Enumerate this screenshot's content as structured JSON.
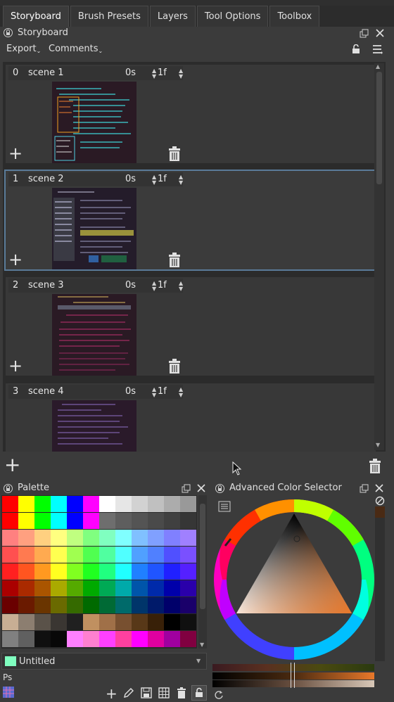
{
  "tabs": [
    {
      "label": "Storyboard",
      "active": true
    },
    {
      "label": "Brush Presets",
      "active": false
    },
    {
      "label": "Layers",
      "active": false
    },
    {
      "label": "Tool Options",
      "active": false
    },
    {
      "label": "Toolbox",
      "active": false
    }
  ],
  "storyboard": {
    "title": "Storyboard",
    "export_label": "Export",
    "comments_label": "Comments",
    "scenes": [
      {
        "index": "0",
        "name": "scene 1",
        "duration": "0s",
        "frames": "1f",
        "selected": false
      },
      {
        "index": "1",
        "name": "scene 2",
        "duration": "0s",
        "frames": "1f",
        "selected": true
      },
      {
        "index": "2",
        "name": "scene 3",
        "duration": "0s",
        "frames": "1f",
        "selected": false
      },
      {
        "index": "3",
        "name": "scene 4",
        "duration": "0s",
        "frames": "1f",
        "selected": false
      }
    ]
  },
  "palette": {
    "title": "Palette",
    "name": "Untitled",
    "ps_label": "Ps",
    "rows": [
      [
        "#ff0000",
        "#ffff00",
        "#00ff00",
        "#00ffff",
        "#0000ff",
        "#ff00ff",
        "#ffffff",
        "#e6e6e6",
        "#d2d2d2",
        "#c0c0c0",
        "#acacac",
        "#999999"
      ],
      [
        "#ff0000",
        "#ffff00",
        "#00ff00",
        "#00ffff",
        "#0000ff",
        "#ff00ff",
        "#6e6e6e",
        "#5e5e5e",
        "#545454",
        "#4a4a4a",
        "#404040",
        "#363636"
      ],
      [
        "#ff8080",
        "#ffa080",
        "#ffd080",
        "#ffff80",
        "#c0ff80",
        "#80ff80",
        "#80ffc0",
        "#80ffff",
        "#80c0ff",
        "#80a0ff",
        "#8080ff",
        "#a080ff"
      ],
      [
        "#ff5050",
        "#ff7a50",
        "#ffaa50",
        "#ffff50",
        "#a0ff50",
        "#50ff50",
        "#50ffa0",
        "#50ffff",
        "#50a0ff",
        "#5080ff",
        "#5050ff",
        "#7a50ff"
      ],
      [
        "#ff2020",
        "#ff5520",
        "#ff9920",
        "#ffff20",
        "#80ff20",
        "#20ff20",
        "#20ff80",
        "#20ffff",
        "#2080ff",
        "#2055ff",
        "#2020ff",
        "#5520ff"
      ],
      [
        "#aa0000",
        "#aa2a00",
        "#aa5500",
        "#aaaa00",
        "#55aa00",
        "#00aa00",
        "#00aa55",
        "#00aaaa",
        "#0055aa",
        "#002aaa",
        "#0000aa",
        "#2a00aa"
      ],
      [
        "#6a0000",
        "#6a1a00",
        "#6a3500",
        "#6a6a00",
        "#356a00",
        "#006a00",
        "#006a35",
        "#006a6a",
        "#00356a",
        "#001a6a",
        "#00006a",
        "#1a006a"
      ],
      [
        "#c8ae94",
        "#8c7e70",
        "#5a5249",
        "#3a3632",
        "#202020",
        "#c09060",
        "#a07048",
        "#785030",
        "#583818",
        "#382008",
        "#000000",
        "#101010"
      ],
      [
        "#808080",
        "#606060",
        "#101010",
        "#080808",
        "#ff80ff",
        "#ff80d0",
        "#ff40ff",
        "#ff40a0",
        "#ff00ff",
        "#e000a0",
        "#a000a0",
        "#800040"
      ]
    ]
  },
  "color_selector": {
    "title": "Advanced Color Selector",
    "current_color": "#e8782a"
  },
  "icons": {
    "lock": "lock-icon",
    "float": "float-icon",
    "close": "close-icon",
    "add": "plus-icon",
    "delete": "trash-icon",
    "menu": "hamburger-icon"
  }
}
